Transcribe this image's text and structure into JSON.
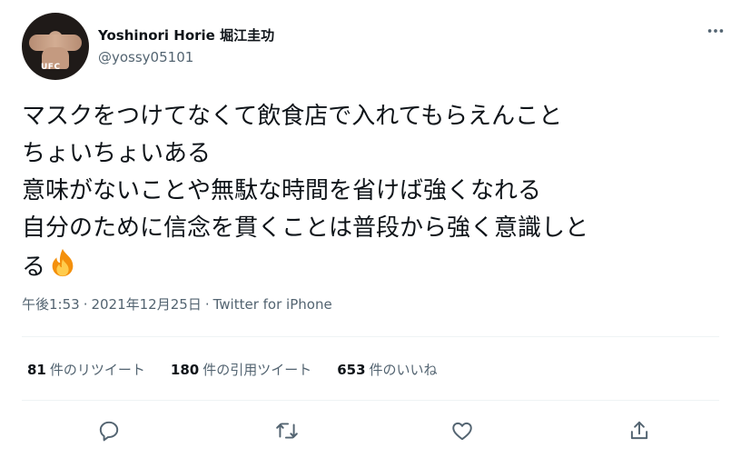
{
  "author": {
    "display_name": "Yoshinori Horie 堀江圭功",
    "handle": "@yossy05101",
    "avatar_text": "UFC"
  },
  "tweet": {
    "lines": [
      "マスクをつけてなくて飲食店で入れてもらえんこと",
      "ちょいちょいある",
      "意味がないことや無駄な時間を省けば強くなれる",
      "自分のために信念を貫くことは普段から強く意識しと",
      "る"
    ],
    "emoji": "fire"
  },
  "meta": {
    "time": "午後1:53",
    "separator1": "·",
    "date": "2021年12月25日",
    "separator2": "·",
    "source": "Twitter for iPhone"
  },
  "stats": {
    "retweets_count": "81",
    "retweets_label": "件のリツイート",
    "quotes_count": "180",
    "quotes_label": "件の引用ツイート",
    "likes_count": "653",
    "likes_label": "件のいいね"
  },
  "icons": [
    "more-icon",
    "reply-icon",
    "retweet-icon",
    "like-icon",
    "share-icon"
  ],
  "colors": {
    "text": "#0f1419",
    "secondary": "#536471",
    "divider": "#eff3f4"
  }
}
